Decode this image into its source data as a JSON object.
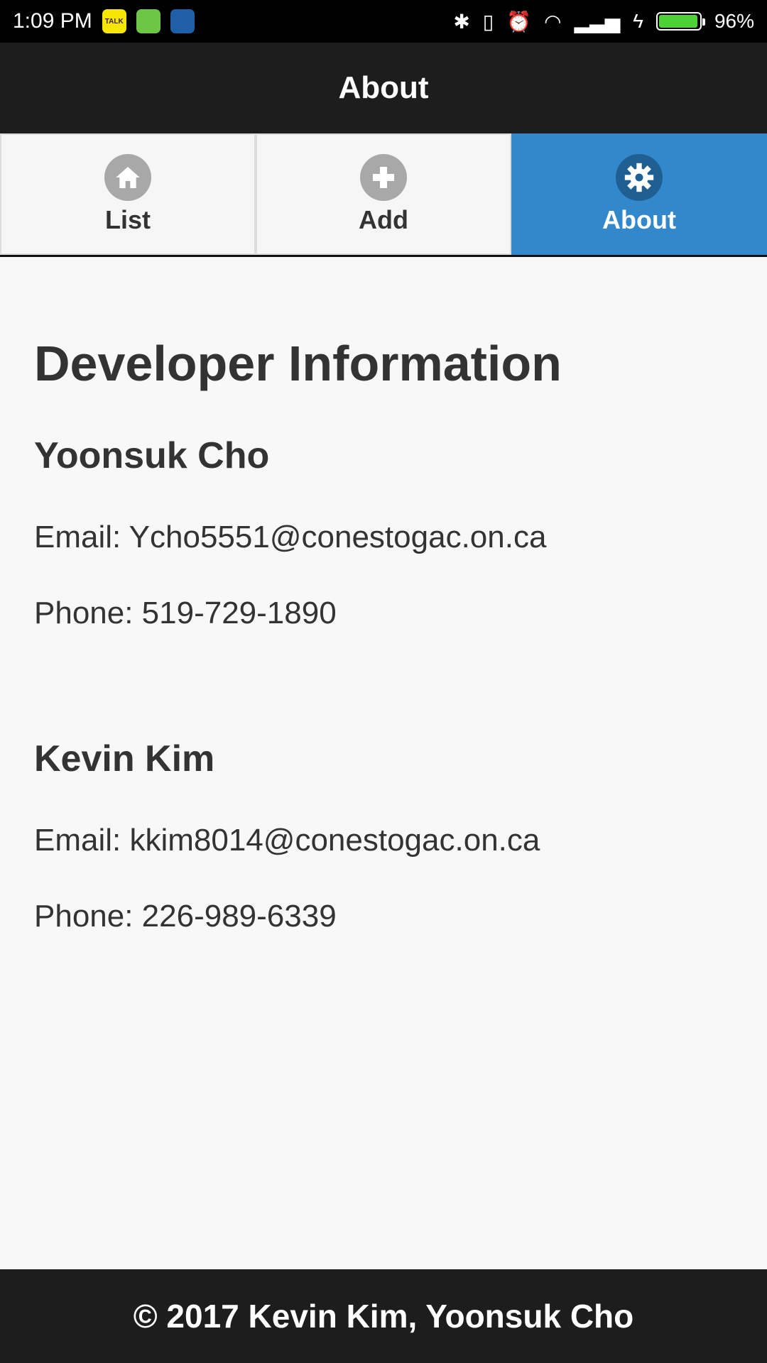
{
  "status_bar": {
    "time": "1:09 PM",
    "battery_percent": "96%",
    "battery_level": 0.96,
    "icons": [
      "kakaotalk-icon",
      "battery-app-icon",
      "weather-icon",
      "bluetooth-icon",
      "vibrate-icon",
      "alarm-icon",
      "wifi-icon",
      "signal-icon",
      "charging-icon",
      "battery-icon"
    ]
  },
  "header": {
    "title": "About"
  },
  "navbar": {
    "tabs": [
      {
        "label": "List",
        "icon": "home-icon"
      },
      {
        "label": "Add",
        "icon": "plus-icon"
      },
      {
        "label": "About",
        "icon": "gear-icon",
        "active": true
      }
    ]
  },
  "content": {
    "heading": "Developer Information",
    "developers": [
      {
        "name": "Yoonsuk Cho",
        "email": "Email: Ycho5551@conestogac.on.ca",
        "phone": "Phone: 519-729-1890"
      },
      {
        "name": "Kevin Kim",
        "email": "Email: kkim8014@conestogac.on.ca",
        "phone": "Phone: 226-989-6339"
      }
    ]
  },
  "footer": {
    "text": "© 2017 Kevin Kim, Yoonsuk Cho"
  },
  "colors": {
    "accent": "#3388cc",
    "header_bg": "#1d1d1d",
    "page_bg": "#f8f8f8"
  }
}
